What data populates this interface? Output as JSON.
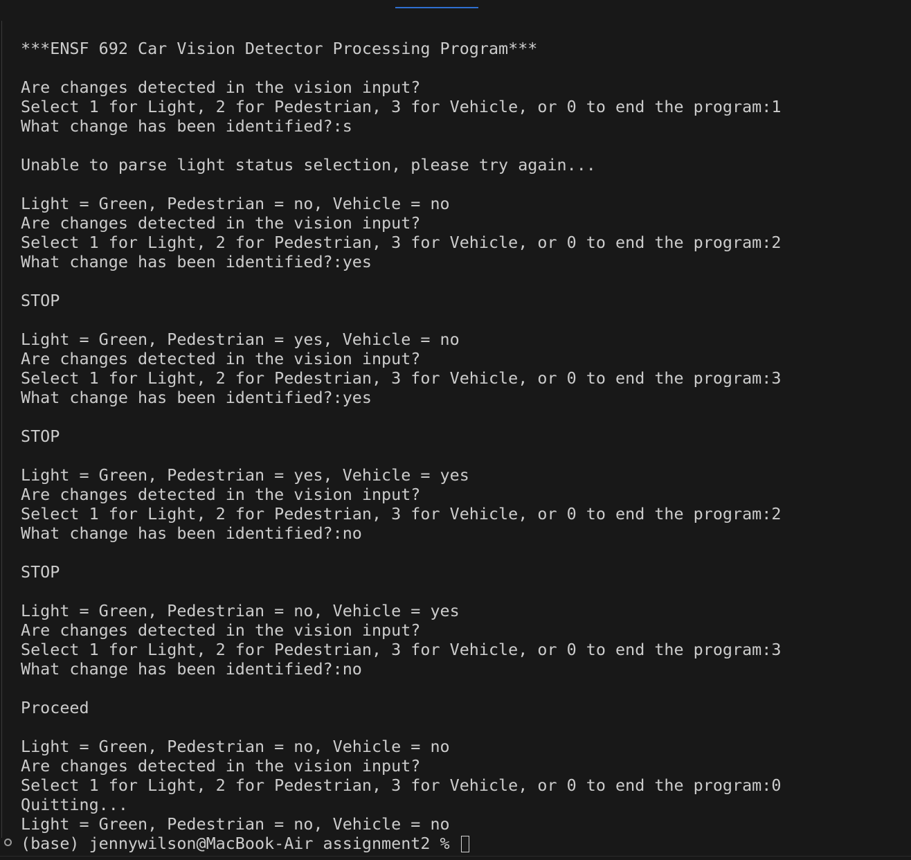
{
  "terminal": {
    "lines": [
      "***ENSF 692 Car Vision Detector Processing Program***",
      "",
      "Are changes detected in the vision input?",
      "Select 1 for Light, 2 for Pedestrian, 3 for Vehicle, or 0 to end the program:1",
      "What change has been identified?:s",
      "",
      "Unable to parse light status selection, please try again...",
      "",
      "Light = Green, Pedestrian = no, Vehicle = no",
      "Are changes detected in the vision input?",
      "Select 1 for Light, 2 for Pedestrian, 3 for Vehicle, or 0 to end the program:2",
      "What change has been identified?:yes",
      "",
      "STOP",
      "",
      "Light = Green, Pedestrian = yes, Vehicle = no",
      "Are changes detected in the vision input?",
      "Select 1 for Light, 2 for Pedestrian, 3 for Vehicle, or 0 to end the program:3",
      "What change has been identified?:yes",
      "",
      "STOP",
      "",
      "Light = Green, Pedestrian = yes, Vehicle = yes",
      "Are changes detected in the vision input?",
      "Select 1 for Light, 2 for Pedestrian, 3 for Vehicle, or 0 to end the program:2",
      "What change has been identified?:no",
      "",
      "STOP",
      "",
      "Light = Green, Pedestrian = no, Vehicle = yes",
      "Are changes detected in the vision input?",
      "Select 1 for Light, 2 for Pedestrian, 3 for Vehicle, or 0 to end the program:3",
      "What change has been identified?:no",
      "",
      "Proceed",
      "",
      "Light = Green, Pedestrian = no, Vehicle = no",
      "Are changes detected in the vision input?",
      "Select 1 for Light, 2 for Pedestrian, 3 for Vehicle, or 0 to end the program:0",
      "Quitting...",
      "Light = Green, Pedestrian = no, Vehicle = no"
    ],
    "prompt": "(base) jennywilson@MacBook-Air assignment2 % ",
    "prompt_status_icon": "hollow-circle-icon",
    "cursor_icon": "block-cursor-icon"
  },
  "colors": {
    "background": "#181818",
    "text": "#cccccc",
    "tab_indicator": "#2f6fd0"
  }
}
